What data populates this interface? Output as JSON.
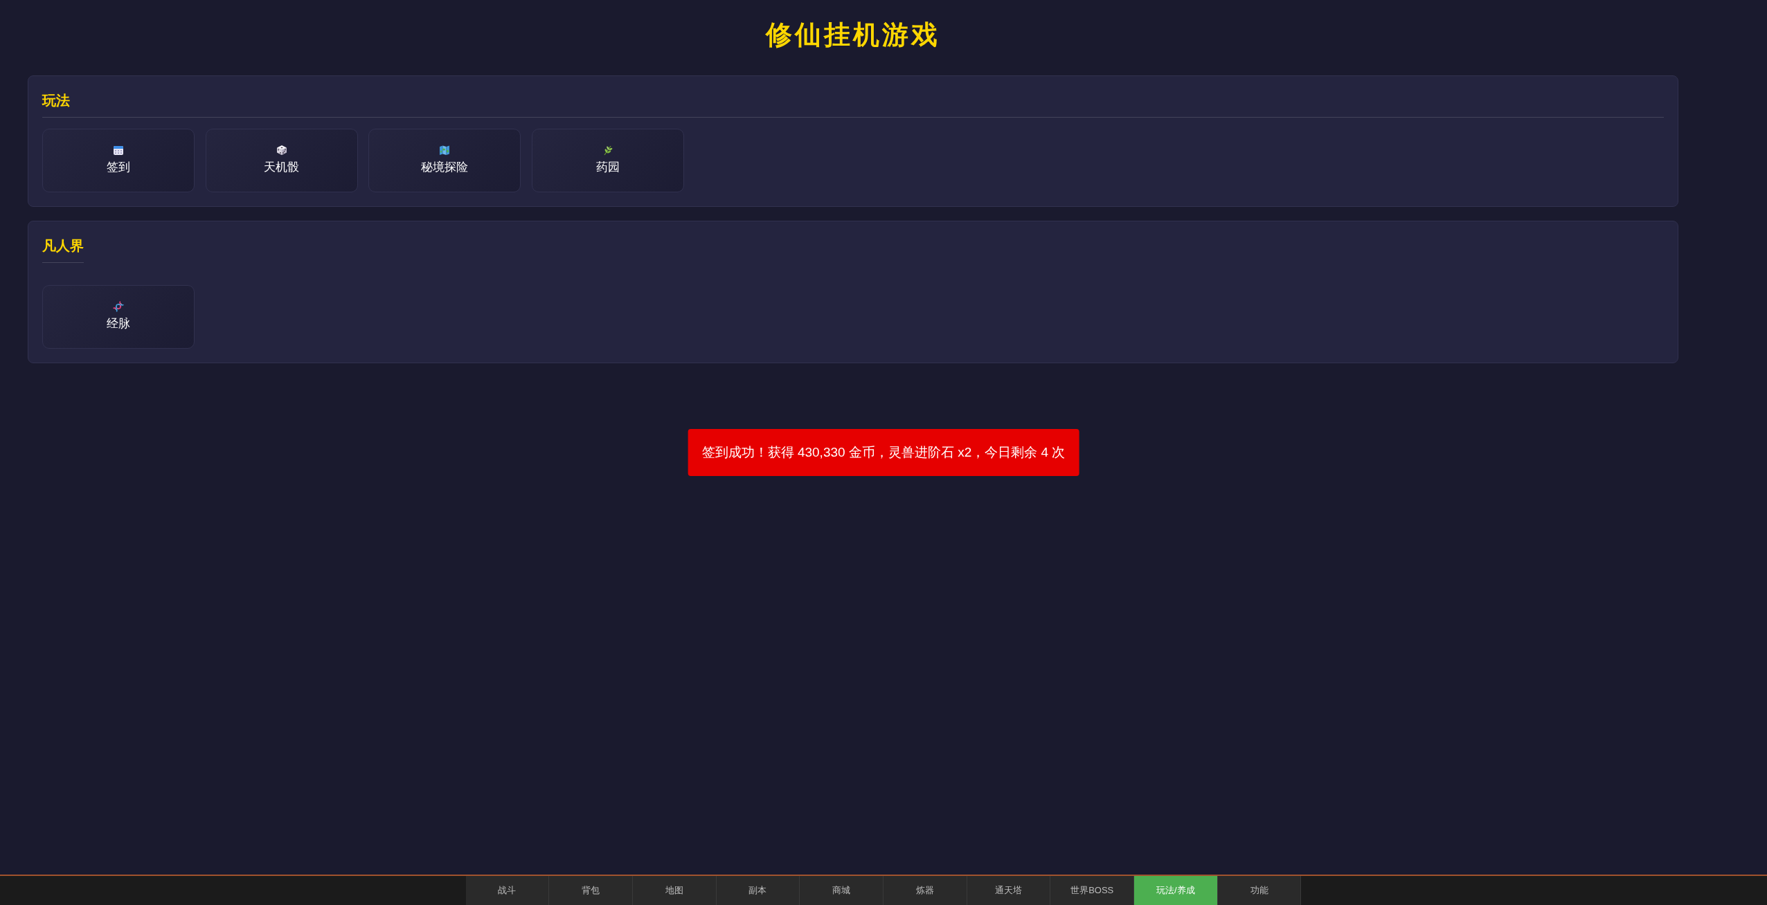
{
  "title": "修仙挂机游戏",
  "sections": [
    {
      "title": "玩法",
      "kind": "wide",
      "items": [
        {
          "label": "签到"
        },
        {
          "label": "天机骰"
        },
        {
          "label": "秘境探险"
        },
        {
          "label": "药园"
        }
      ]
    },
    {
      "title": "凡人界",
      "kind": "short",
      "items": [
        {
          "label": "经脉"
        }
      ]
    }
  ],
  "toast": {
    "text": "签到成功！获得 430,330 金币，灵兽进阶石 x2，今日剩余 4 次"
  },
  "nav": [
    {
      "label": "战斗",
      "selected": false
    },
    {
      "label": "背包",
      "selected": false
    },
    {
      "label": "地图",
      "selected": false
    },
    {
      "label": "副本",
      "selected": false
    },
    {
      "label": "商城",
      "selected": false
    },
    {
      "label": "炼器",
      "selected": false
    },
    {
      "label": "通天塔",
      "selected": false
    },
    {
      "label": "世界BOSS",
      "selected": false
    },
    {
      "label": "玩法/养成",
      "selected": true
    },
    {
      "label": "功能",
      "selected": false
    }
  ]
}
